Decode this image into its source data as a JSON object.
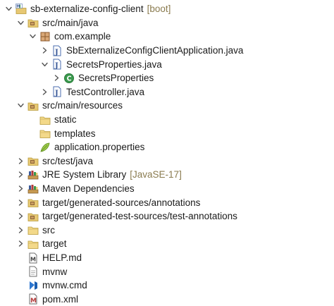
{
  "tree": [
    {
      "label": "sb-externalize-config-client",
      "decoration": "[boot]",
      "icon": "maven-boot-project-icon",
      "chevron": "down",
      "depth": 0
    },
    {
      "label": "src/main/java",
      "decoration": "",
      "icon": "source-folder-icon",
      "chevron": "down",
      "depth": 1
    },
    {
      "label": "com.example",
      "decoration": "",
      "icon": "package-icon",
      "chevron": "down",
      "depth": 2
    },
    {
      "label": "SbExternalizeConfigClientApplication.java",
      "decoration": "",
      "icon": "java-file-icon",
      "chevron": "right",
      "depth": 3
    },
    {
      "label": "SecretsProperties.java",
      "decoration": "",
      "icon": "java-file-icon",
      "chevron": "down",
      "depth": 3
    },
    {
      "label": "SecretsProperties",
      "decoration": "",
      "icon": "class-icon",
      "chevron": "right",
      "depth": 4
    },
    {
      "label": "TestController.java",
      "decoration": "",
      "icon": "java-file-icon",
      "chevron": "right",
      "depth": 3
    },
    {
      "label": "src/main/resources",
      "decoration": "",
      "icon": "source-folder-icon",
      "chevron": "down",
      "depth": 1
    },
    {
      "label": "static",
      "decoration": "",
      "icon": "folder-icon",
      "chevron": "none",
      "depth": 2
    },
    {
      "label": "templates",
      "decoration": "",
      "icon": "folder-icon",
      "chevron": "none",
      "depth": 2
    },
    {
      "label": "application.properties",
      "decoration": "",
      "icon": "properties-file-icon",
      "chevron": "none",
      "depth": 2
    },
    {
      "label": "src/test/java",
      "decoration": "",
      "icon": "source-folder-icon",
      "chevron": "right",
      "depth": 1
    },
    {
      "label": "JRE System Library",
      "decoration": "[JavaSE-17]",
      "icon": "library-icon",
      "chevron": "right",
      "depth": 1
    },
    {
      "label": "Maven Dependencies",
      "decoration": "",
      "icon": "library-icon",
      "chevron": "right",
      "depth": 1
    },
    {
      "label": "target/generated-sources/annotations",
      "decoration": "",
      "icon": "source-folder-icon",
      "chevron": "right",
      "depth": 1
    },
    {
      "label": "target/generated-test-sources/test-annotations",
      "decoration": "",
      "icon": "source-folder-icon",
      "chevron": "right",
      "depth": 1
    },
    {
      "label": "src",
      "decoration": "",
      "icon": "folder-icon",
      "chevron": "right",
      "depth": 1
    },
    {
      "label": "target",
      "decoration": "",
      "icon": "folder-icon",
      "chevron": "right",
      "depth": 1
    },
    {
      "label": "HELP.md",
      "decoration": "",
      "icon": "markdown-file-icon",
      "chevron": "none",
      "depth": 1
    },
    {
      "label": "mvnw",
      "decoration": "",
      "icon": "text-file-icon",
      "chevron": "none",
      "depth": 1
    },
    {
      "label": "mvnw.cmd",
      "decoration": "",
      "icon": "cmd-file-icon",
      "chevron": "none",
      "depth": 1
    },
    {
      "label": "pom.xml",
      "decoration": "",
      "icon": "maven-pom-icon",
      "chevron": "none",
      "depth": 1
    }
  ],
  "colors": {
    "decoration": "#8a7b4f",
    "chevron": "#555555",
    "folder": "#e7c873",
    "package": "#b07a4e",
    "class": "#3b9a4e",
    "javaFile": "#4b6eaf",
    "maven": "#b33a3a"
  }
}
